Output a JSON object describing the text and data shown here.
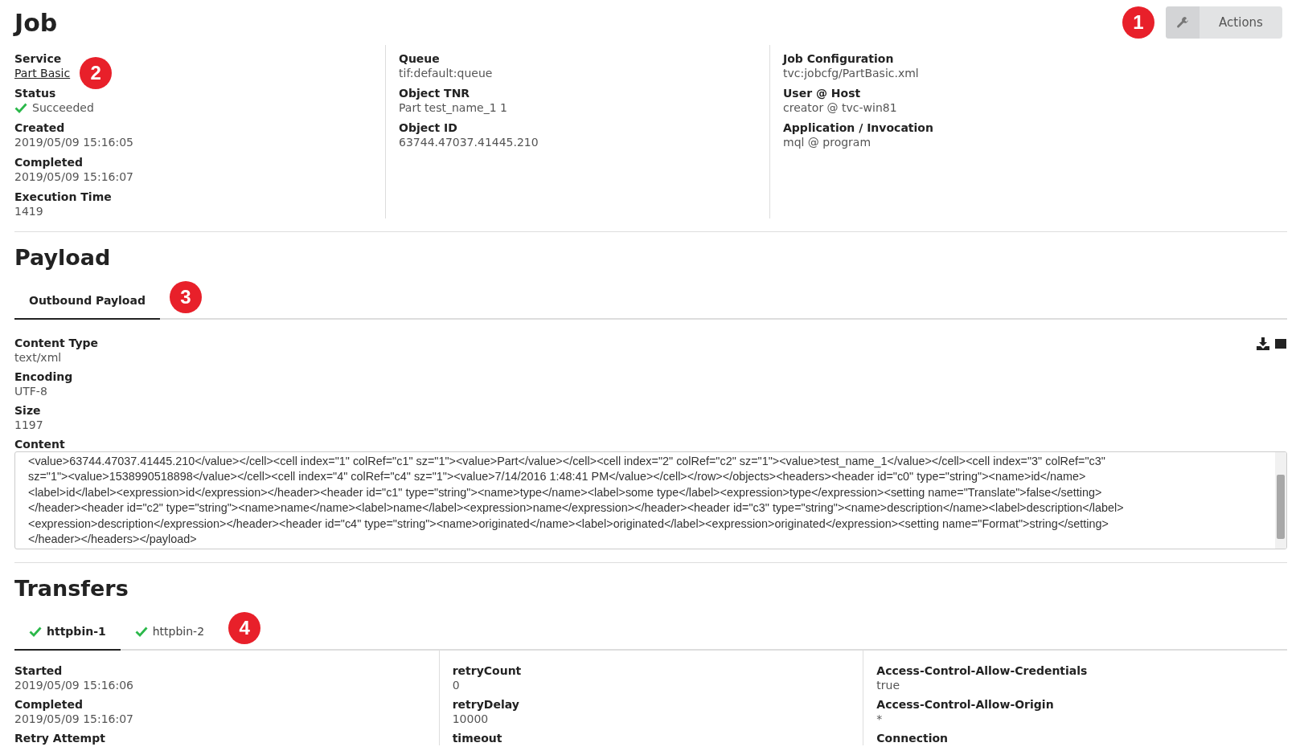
{
  "header": {
    "title": "Job",
    "callout": "1",
    "actions_button": {
      "label": "Actions"
    }
  },
  "job_details": {
    "callout": "2",
    "columns": [
      [
        {
          "label": "Service",
          "value": "Part Basic",
          "kind": "link",
          "callout": true
        },
        {
          "label": "Status",
          "value": "Succeeded",
          "kind": "status"
        },
        {
          "label": "Created",
          "value": "2019/05/09 15:16:05",
          "kind": "text"
        },
        {
          "label": "Completed",
          "value": "2019/05/09 15:16:07",
          "kind": "text"
        },
        {
          "label": "Execution Time",
          "value": "1419",
          "kind": "text"
        }
      ],
      [
        {
          "label": "Queue",
          "value": "tif:default:queue",
          "kind": "text"
        },
        {
          "label": "Object TNR",
          "value": "Part test_name_1 1",
          "kind": "text"
        },
        {
          "label": "Object ID",
          "value": "63744.47037.41445.210",
          "kind": "text"
        }
      ],
      [
        {
          "label": "Job Configuration",
          "value": "tvc:jobcfg/PartBasic.xml",
          "kind": "text"
        },
        {
          "label": "User @ Host",
          "value": "creator @ tvc-win81",
          "kind": "text"
        },
        {
          "label": "Application / Invocation",
          "value": "mql @ program",
          "kind": "text"
        }
      ]
    ]
  },
  "payload": {
    "title": "Payload",
    "callout": "3",
    "tabs": [
      {
        "label": "Outbound Payload",
        "selected": true
      }
    ],
    "fields": [
      {
        "label": "Content Type",
        "value": "text/xml"
      },
      {
        "label": "Encoding",
        "value": "UTF-8"
      },
      {
        "label": "Size",
        "value": "1197"
      }
    ],
    "content": {
      "label": "Content",
      "lines": [
        "<value>63744.47037.41445.210</value></cell><cell index=\"1\" colRef=\"c1\" sz=\"1\"><value>Part</value></cell><cell index=\"2\" colRef=\"c2\" sz=\"1\"><value>test_name_1</value></cell><cell index=\"3\" colRef=\"c3\"",
        "sz=\"1\"><value>1538990518898</value></cell><cell index=\"4\" colRef=\"c4\" sz=\"1\"><value>7/14/2016 1:48:41 PM</value></cell></row></objects><headers><header id=\"c0\" type=\"string\"><name>id</name>",
        "<label>id</label><expression>id</expression></header><header id=\"c1\" type=\"string\"><name>type</name><label>some type</label><expression>type</expression><setting name=\"Translate\">false</setting>",
        "</header><header id=\"c2\" type=\"string\"><name>name</name><label>name</label><expression>name</expression></header><header id=\"c3\" type=\"string\"><name>description</name><label>description</label>",
        "<expression>description</expression></header><header id=\"c4\" type=\"string\"><name>originated</name><label>originated</label><expression>originated</expression><setting name=\"Format\">string</setting>",
        "</header></headers></payload>"
      ]
    }
  },
  "transfers": {
    "title": "Transfers",
    "callout": "4",
    "tabs": [
      {
        "label": "httpbin-1",
        "selected": true,
        "succeeded": true
      },
      {
        "label": "httpbin-2",
        "selected": false,
        "succeeded": true
      }
    ],
    "columns": [
      [
        {
          "label": "Started",
          "value": "2019/05/09 15:16:06"
        },
        {
          "label": "Completed",
          "value": "2019/05/09 15:16:07"
        },
        {
          "label": "Retry Attempt"
        }
      ],
      [
        {
          "label": "retryCount",
          "value": "0"
        },
        {
          "label": "retryDelay",
          "value": "10000"
        },
        {
          "label": "timeout"
        }
      ],
      [
        {
          "label": "Access-Control-Allow-Credentials",
          "value": "true"
        },
        {
          "label": "Access-Control-Allow-Origin",
          "value": "*"
        },
        {
          "label": "Connection"
        }
      ]
    ]
  }
}
